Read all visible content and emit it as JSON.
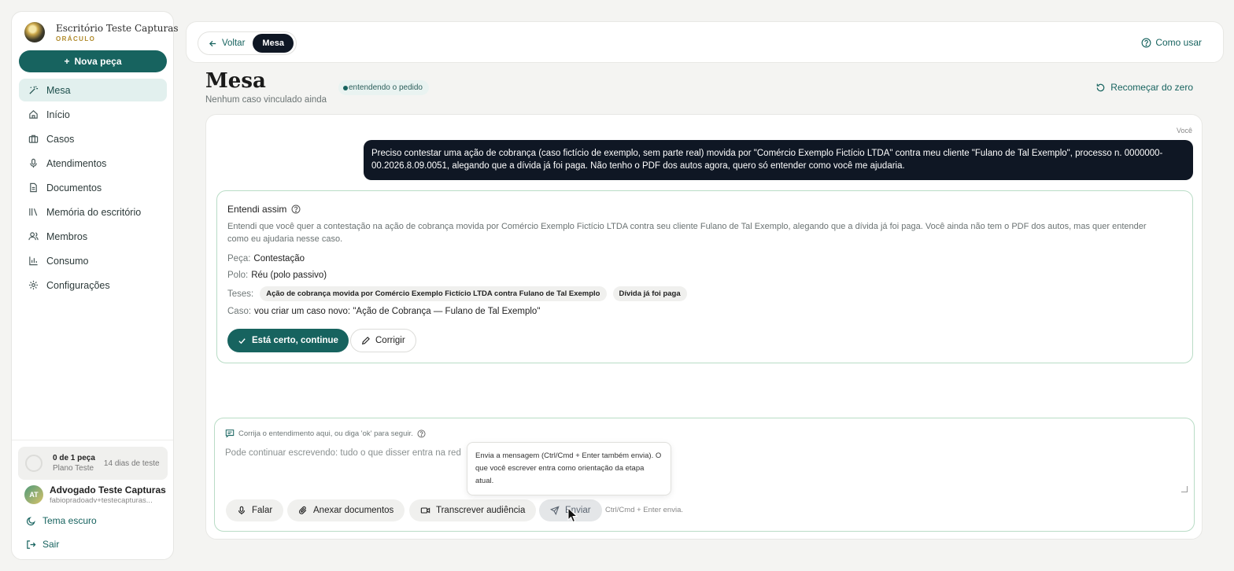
{
  "brand": {
    "name": "Escritório Teste Capturas",
    "sub": "ORÁCULO"
  },
  "sidebar": {
    "new_label": "Nova peça",
    "items": [
      {
        "label": "Mesa",
        "icon": "magic-wand-icon"
      },
      {
        "label": "Início",
        "icon": "home-icon"
      },
      {
        "label": "Casos",
        "icon": "briefcase-icon"
      },
      {
        "label": "Atendimentos",
        "icon": "microphone-icon"
      },
      {
        "label": "Documentos",
        "icon": "document-icon"
      },
      {
        "label": "Memória do escritório",
        "icon": "library-icon"
      },
      {
        "label": "Membros",
        "icon": "users-icon"
      },
      {
        "label": "Consumo",
        "icon": "bar-chart-icon"
      },
      {
        "label": "Configurações",
        "icon": "gear-icon"
      }
    ],
    "plan": {
      "title": "0 de 1 peça",
      "sub": "Plano Teste",
      "days": "14 dias de teste"
    },
    "user": {
      "initials": "AT",
      "name": "Advogado Teste Capturas",
      "email": "fabiopradoadv+testecapturas..."
    },
    "theme_label": "Tema escuro",
    "logout_label": "Sair"
  },
  "topbar": {
    "back_label": "Voltar",
    "active_label": "Mesa",
    "howto_label": "Como usar"
  },
  "header": {
    "title": "Mesa",
    "subtitle": "Nenhum caso vinculado ainda",
    "status": "entendendo o pedido",
    "restart_label": "Recomeçar do zero"
  },
  "chat": {
    "you_label": "Você",
    "message": "Preciso contestar uma ação de cobrança (caso fictício de exemplo, sem parte real) movida por \"Comércio Exemplo Fictício LTDA\" contra meu cliente \"Fulano de Tal Exemplo\", processo n. 0000000-00.2026.8.09.0051, alegando que a dívida já foi paga. Não tenho o PDF dos autos agora, quero só entender como você me ajudaria.",
    "card": {
      "title": "Entendi assim",
      "description": "Entendi que você quer a contestação na ação de cobrança movida por Comércio Exemplo Fictício LTDA contra seu cliente Fulano de Tal Exemplo, alegando que a dívida já foi paga. Você ainda não tem o PDF dos autos, mas quer entender como eu ajudaria nesse caso.",
      "peca_label": "Peça:",
      "peca_value": "Contestação",
      "polo_label": "Polo:",
      "polo_value": "Réu (polo passivo)",
      "teses_label": "Teses:",
      "teses": [
        "Ação de cobrança movida por Comércio Exemplo Fictício LTDA contra Fulano de Tal Exemplo",
        "Dívida já foi paga"
      ],
      "caso_label": "Caso:",
      "caso_value": "vou criar um caso novo: \"Ação de Cobrança — Fulano de Tal Exemplo\"",
      "confirm_label": "Está certo, continue",
      "correct_label": "Corrigir"
    }
  },
  "composer": {
    "hint": "Corrija o entendimento aqui, ou diga 'ok' para seguir.",
    "placeholder": "Pode continuar escrevendo: tudo o que disser entra na red",
    "speak_label": "Falar",
    "attach_label": "Anexar documentos",
    "transcribe_label": "Transcrever audiência",
    "send_label": "Enviar",
    "kbd_hint": "Ctrl/Cmd + Enter envia.",
    "tooltip": "Envia a mensagem (Ctrl/Cmd + Enter também envia). O que você escrever entra como orientação da etapa atual."
  },
  "colors": {
    "accent": "#17635f",
    "dark": "#0f1724",
    "card_border": "#b9dcc6"
  }
}
